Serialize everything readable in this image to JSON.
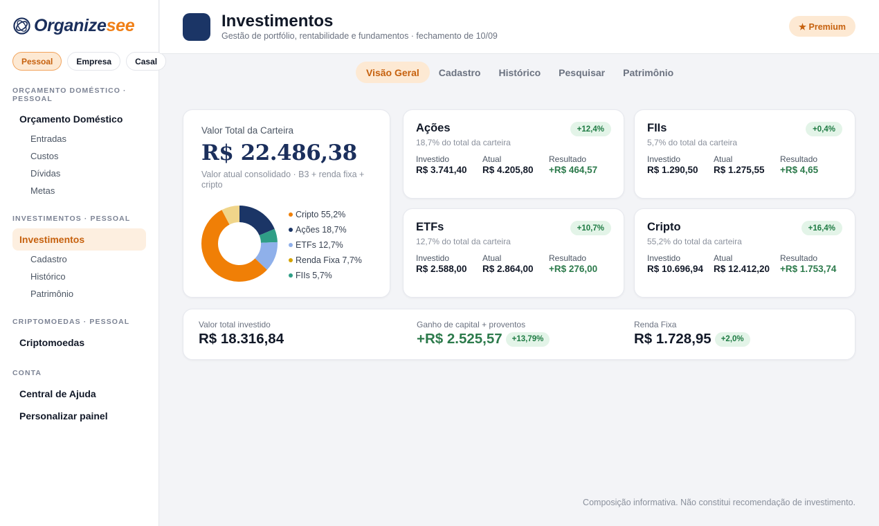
{
  "brand": {
    "name_part1": "Organize",
    "name_part2": "see"
  },
  "profiles": [
    {
      "label": "Pessoal",
      "active": true
    },
    {
      "label": "Empresa",
      "active": false
    },
    {
      "label": "Casal",
      "active": false
    }
  ],
  "sidebar": {
    "sections": [
      {
        "title": "ORÇAMENTO DOMÉSTICO · PESSOAL",
        "item": "Orçamento Doméstico",
        "subitems": [
          "Entradas",
          "Custos",
          "Dívidas",
          "Metas"
        ]
      },
      {
        "title": "INVESTIMENTOS · PESSOAL",
        "item": "Investimentos",
        "subitems": [
          "Cadastro",
          "Histórico",
          "Patrimônio"
        ]
      },
      {
        "title": "CRIPTOMOEDAS · PESSOAL",
        "item": "Criptomoedas"
      },
      {
        "title": "CONTA",
        "items": [
          "Central de Ajuda",
          "Personalizar painel"
        ]
      }
    ]
  },
  "header": {
    "title": "Investimentos",
    "subtitle": "Gestão de portfólio, rentabilidade e fundamentos · fechamento de 10/09",
    "premium_label": "★ Premium"
  },
  "tabs": [
    {
      "label": "Visão Geral",
      "active": true
    },
    {
      "label": "Cadastro",
      "active": false
    },
    {
      "label": "Histórico",
      "active": false
    },
    {
      "label": "Pesquisar",
      "active": false
    },
    {
      "label": "Patrimônio",
      "active": false
    }
  ],
  "portfolio": {
    "label": "Valor Total da Carteira",
    "value": "R$ 22.486,38",
    "description": "Valor atual consolidado · B3 + renda fixa + cripto",
    "allocation": [
      {
        "label": "Cripto 55,2%",
        "percent": 55.2,
        "color": "#f07f06"
      },
      {
        "label": "Ações 18,7%",
        "percent": 18.7,
        "color": "#1b3566"
      },
      {
        "label": "ETFs 12,7%",
        "percent": 12.7,
        "color": "#8fb0ea"
      },
      {
        "label": "Renda Fixa 7,7%",
        "percent": 7.7,
        "color": "#f0d58a"
      },
      {
        "label": "FIIs 5,7%",
        "percent": 5.7,
        "color": "#2f9e86"
      }
    ],
    "donut_order_clockwise": [
      "Ações",
      "FIIs",
      "ETFs",
      "Cripto",
      "Renda Fixa"
    ]
  },
  "metric_labels": {
    "invested": "Investido",
    "current": "Atual",
    "result": "Resultado"
  },
  "assets": [
    {
      "name": "Ações",
      "share": "18,7% do total da carteira",
      "badge": "+12,4%",
      "invested": "R$ 3.741,40",
      "current": "R$ 4.205,80",
      "result": "+R$ 464,57"
    },
    {
      "name": "FIIs",
      "share": "5,7% do total da carteira",
      "badge": "+0,4%",
      "invested": "R$ 1.290,50",
      "current": "R$ 1.275,55",
      "result": "+R$ 4,65"
    },
    {
      "name": "ETFs",
      "share": "12,7% do total da carteira",
      "badge": "+10,7%",
      "invested": "R$ 2.588,00",
      "current": "R$ 2.864,00",
      "result": "+R$ 276,00"
    },
    {
      "name": "Cripto",
      "share": "55,2% do total da carteira",
      "badge": "+16,4%",
      "invested": "R$ 10.696,94",
      "current": "R$ 12.412,20",
      "result": "+R$ 1.753,74"
    }
  ],
  "summary": {
    "invested_label": "Valor total investido",
    "invested_value": "R$ 18.316,84",
    "gain_label": "Ganho de capital + proventos",
    "gain_value": "+R$ 2.525,57",
    "gain_badge": "+13,79%",
    "fixed_label": "Renda Fixa",
    "fixed_value": "R$ 1.728,95",
    "fixed_badge": "+2,0%"
  },
  "disclaimer": "Composição informativa. Não constitui recomendação de investimento."
}
